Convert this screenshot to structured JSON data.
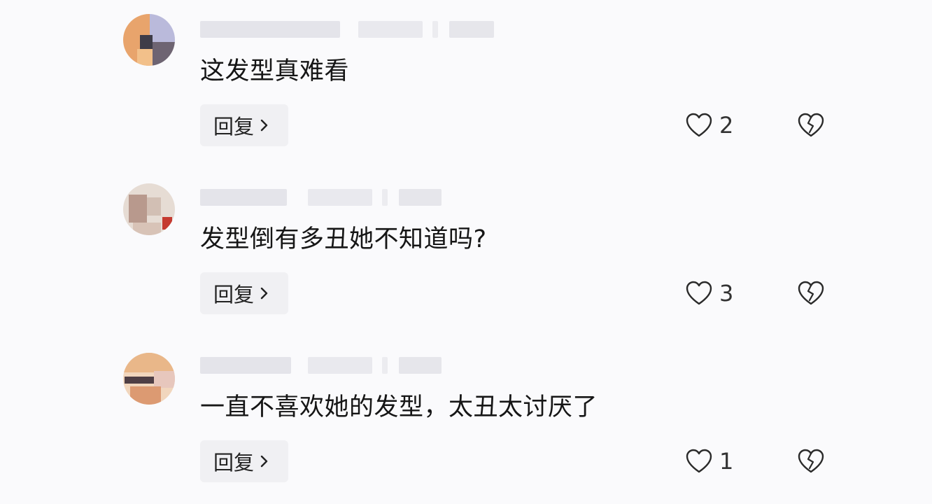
{
  "comments": [
    {
      "text": "这发型真难看",
      "reply_label": "回复",
      "like_count": "2",
      "avatar_colors": [
        "#e7a46a",
        "#b9b9d8",
        "#f2ba7a",
        "#4b4a57",
        "#7a6e6e",
        "#dcdcee"
      ]
    },
    {
      "text": "发型倒有多丑她不知道吗?",
      "reply_label": "回复",
      "like_count": "3",
      "avatar_colors": [
        "#d9c7bd",
        "#b7968a",
        "#e8ddd6",
        "#c6372d",
        "#f0e8e2",
        "#a58a7f"
      ]
    },
    {
      "text": "一直不喜欢她的发型，太丑太讨厌了",
      "reply_label": "回复",
      "like_count": "1",
      "avatar_colors": [
        "#e8b27f",
        "#f3d9bf",
        "#5e4a4f",
        "#d89672",
        "#ead0c8",
        "#c9a48d"
      ]
    }
  ],
  "colors": {
    "background": "#fafafc",
    "reply_bg": "#f0f0f3",
    "icon_stroke": "#2a2a2a",
    "meta_blur": "#e2e2e8"
  },
  "icons": {
    "like": "heart-outline-icon",
    "dislike": "broken-heart-icon",
    "reply_chevron": "chevron-right-icon"
  }
}
